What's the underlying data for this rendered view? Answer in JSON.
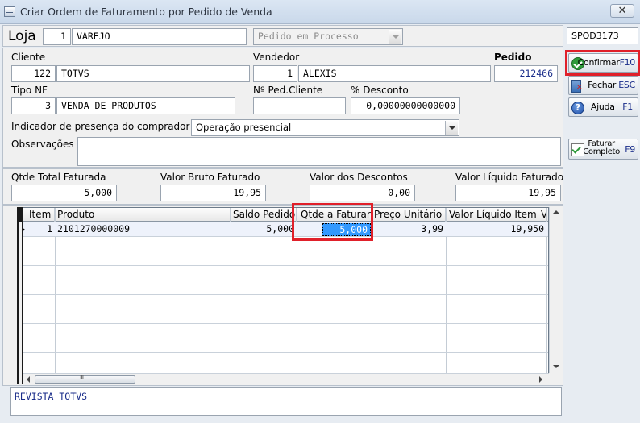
{
  "window": {
    "title": "Criar Ordem de Faturamento por Pedido de Venda",
    "close_label": "✕"
  },
  "header": {
    "loja_label": "Loja",
    "loja_code": "1",
    "loja_name": "VAREJO",
    "status": "Pedido em Processo"
  },
  "order_code": "SPOD3173",
  "form": {
    "cliente_label": "Cliente",
    "cliente_code": "122",
    "cliente_name": "TOTVS",
    "vendedor_label": "Vendedor",
    "vendedor_code": "1",
    "vendedor_name": "ALEXIS",
    "pedido_label": "Pedido",
    "pedido_value": "212466",
    "tipo_nf_label": "Tipo NF",
    "tipo_nf_code": "3",
    "tipo_nf_name": "VENDA DE PRODUTOS",
    "ped_cliente_label": "Nº Ped.Cliente",
    "ped_cliente_value": "",
    "desconto_label": "% Desconto",
    "desconto_value": "0,00000000000000",
    "presenca_label": "Indicador de presença do comprador",
    "presenca_value": "Operação presencial",
    "observacoes_label": "Observações",
    "observacoes_value": ""
  },
  "buttons": {
    "confirmar": {
      "label": "Confirmar",
      "key": "F10"
    },
    "fechar": {
      "label": "Fechar",
      "key": "ESC"
    },
    "ajuda": {
      "label": "Ajuda",
      "key": "F1"
    },
    "faturar": {
      "label_line1": "Faturar",
      "label_line2": "Completo",
      "key": "F9"
    }
  },
  "totals": {
    "qtde_total_label": "Qtde Total Faturada",
    "qtde_total_value": "5,000",
    "valor_bruto_label": "Valor Bruto Faturado",
    "valor_bruto_value": "19,95",
    "valor_descontos_label": "Valor dos Descontos",
    "valor_descontos_value": "0,00",
    "valor_liquido_label": "Valor Líquido Faturado",
    "valor_liquido_value": "19,95"
  },
  "grid": {
    "columns": [
      "Item",
      "Produto",
      "Saldo Pedido",
      "Qtde a Faturar",
      "Preço Unitário",
      "Valor Líquido Item",
      "V"
    ],
    "rows": [
      {
        "item": "1",
        "produto": "2101270000009",
        "saldo": "5,000",
        "qtde": "5,000",
        "preco": "3,99",
        "valor": "19,950"
      }
    ]
  },
  "footer_text": "REVISTA TOTVS"
}
